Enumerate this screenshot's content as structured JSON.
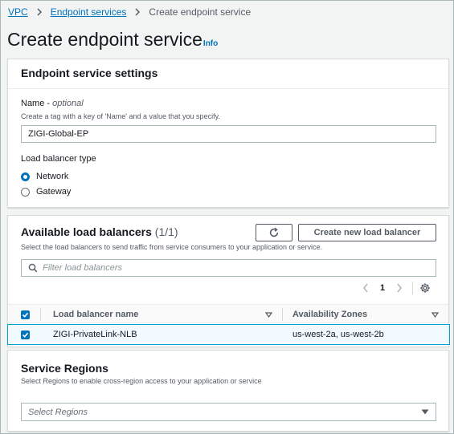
{
  "breadcrumb": {
    "items": [
      "VPC",
      "Endpoint services"
    ],
    "current": "Create endpoint service"
  },
  "page": {
    "title": "Create endpoint service",
    "info": "Info"
  },
  "settings": {
    "title": "Endpoint service settings",
    "name_label": "Name",
    "name_optional": "optional",
    "name_desc": "Create a tag with a key of 'Name' and a value that you specify.",
    "name_value": "ZIGI-Global-EP",
    "lb_type_label": "Load balancer type",
    "lb_types": [
      "Network",
      "Gateway"
    ],
    "lb_type_selected": "Network"
  },
  "available": {
    "title": "Available load balancers",
    "count": "(1/1)",
    "desc": "Select the load balancers to send traffic from service consumers to your application or service.",
    "create_button": "Create new load balancer",
    "filter_placeholder": "Filter load balancers",
    "page": "1",
    "columns": [
      "Load balancer name",
      "Availability Zones"
    ],
    "rows": [
      {
        "name": "ZIGI-PrivateLink-NLB",
        "zones": "us-west-2a, us-west-2b",
        "selected": true
      }
    ]
  },
  "regions": {
    "title": "Service Regions",
    "desc": "Select Regions to enable cross-region access to your application or service",
    "select_placeholder": "Select Regions"
  },
  "colors": {
    "link": "#0073bb",
    "selected_row_bg": "#f1faff",
    "selected_row_border": "#00a1c9"
  }
}
